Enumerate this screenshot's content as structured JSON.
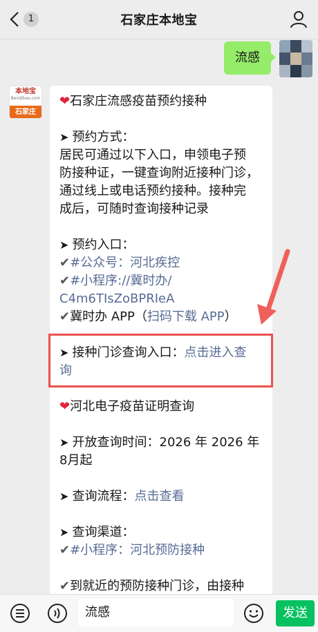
{
  "header": {
    "unread_count": "1",
    "title": "石家庄本地宝"
  },
  "outgoing": {
    "text": "流感"
  },
  "bot_avatar": {
    "logo_top": "本地宝",
    "logo_sub": "Bendibao.com",
    "logo_city": "石家庄"
  },
  "message": {
    "title": "石家庄流感疫苗预约接种",
    "method_heading": "预约方式：",
    "method_lines": [
      "居民可通过以下入口，申领电子预",
      "防接种证，一键查询附近接种门诊，",
      "通过线上或电话预约接种。接种完",
      "成后，可随时查询接种记录"
    ],
    "entry_heading": "预约入口：",
    "entry_public": "#公众号：河北疾控",
    "entry_mini_1": "#小程序://冀时办/",
    "entry_mini_2": "C4m6TIsZoBPRIeA",
    "entry_app_prefix": "冀时办 APP（",
    "entry_app_link": "扫码下载 APP",
    "entry_app_suffix": "）",
    "clinic_label": "接种门诊查询入口：",
    "clinic_link_1": "点击进入查",
    "clinic_link_2": "询",
    "cert_title": "河北电子疫苗证明查询",
    "open_line_1": "开放查询时间：2026 年 2026 年",
    "open_line_2": "8月起",
    "process_label": "查询流程：",
    "process_link": "点击查看",
    "channel_heading": "查询渠道：",
    "channel_mini": "#小程序：河北预防接种",
    "last_line": "到就近的预防接种门诊，由接种"
  },
  "input_bar": {
    "text": "流感",
    "send_label": "发送"
  },
  "icons": {
    "back": "back-chevron-icon",
    "person": "person-icon",
    "voice": "voice-icon",
    "emoji": "emoji-icon",
    "menu": "menu-icon",
    "heart": "heart-icon",
    "arrow": "arrow-bullet-icon",
    "check": "check-icon"
  },
  "colors": {
    "link": "#576b95",
    "bubble_out": "#95ec69",
    "send": "#07c160",
    "highlight": "#e8534d"
  }
}
